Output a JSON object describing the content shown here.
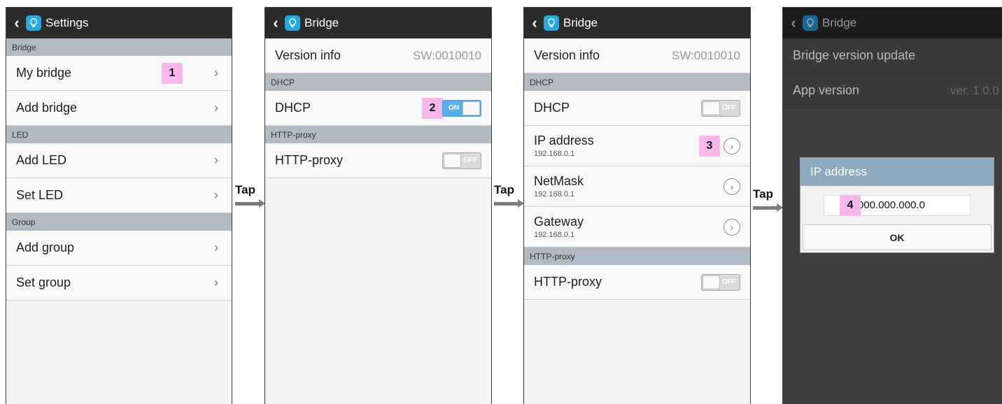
{
  "panel1": {
    "title": "Settings",
    "sections": [
      {
        "label": "Bridge",
        "items": [
          "My bridge",
          "Add bridge"
        ]
      },
      {
        "label": "LED",
        "items": [
          "Add LED",
          "Set LED"
        ]
      },
      {
        "label": "Group",
        "items": [
          "Add group",
          "Set group"
        ]
      }
    ],
    "marker": "1"
  },
  "panel2": {
    "title": "Bridge",
    "version_label": "Version info",
    "version_value": "SW:0010010",
    "dhcp_section": "DHCP",
    "dhcp_label": "DHCP",
    "dhcp_state": "ON",
    "proxy_section": "HTTP-proxy",
    "proxy_label": "HTTP-proxy",
    "proxy_state": "OFF",
    "marker": "2"
  },
  "panel3": {
    "title": "Bridge",
    "version_label": "Version info",
    "version_value": "SW:0010010",
    "dhcp_section": "DHCP",
    "dhcp_label": "DHCP",
    "dhcp_state": "OFF",
    "ip_label": "IP address",
    "ip_value": "192.168.0.1",
    "netmask_label": "NetMask",
    "netmask_value": "192.168.0.1",
    "gateway_label": "Gateway",
    "gateway_value": "192.168.0.1",
    "proxy_section": "HTTP-proxy",
    "proxy_label": "HTTP-proxy",
    "proxy_state": "OFF",
    "marker": "3"
  },
  "panel4": {
    "title": "Bridge",
    "update_label": "Bridge version update",
    "app_version_label": "App version",
    "app_version_value": "ver. 1.0.0",
    "dialog_title": "IP address",
    "dialog_input": "000.000.000.0",
    "dialog_ok": "OK",
    "marker": "4"
  },
  "arrows": {
    "label": "Tap"
  },
  "colors": {
    "topbar": "#2b2b2b",
    "section": "#b0bac3",
    "toggle_on": "#5aaee5",
    "marker": "#f7b7ea",
    "app_icon": "#29a8e0"
  }
}
